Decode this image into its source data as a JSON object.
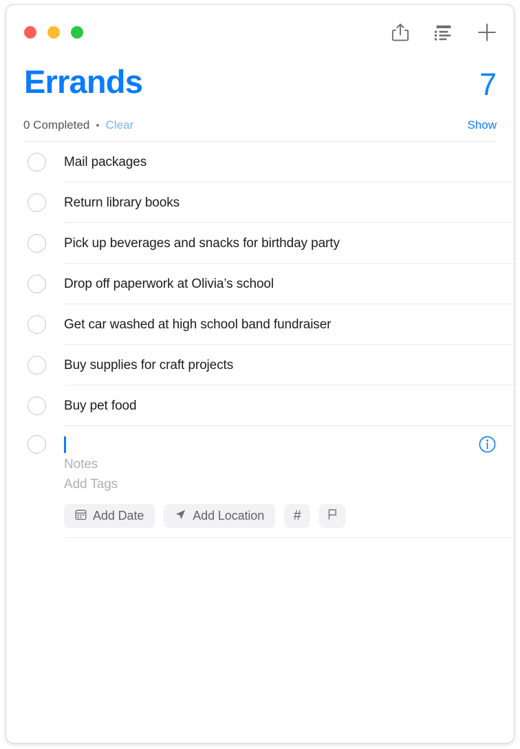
{
  "window": {
    "traffic_lights": [
      {
        "name": "close",
        "color": "#ff5f57"
      },
      {
        "name": "minimize",
        "color": "#febc2e"
      },
      {
        "name": "zoom",
        "color": "#28c840"
      }
    ]
  },
  "toolbar": {
    "items": [
      {
        "icon": "share-icon",
        "label": "Share"
      },
      {
        "icon": "list-view-icon",
        "label": "View Options"
      },
      {
        "icon": "plus-icon",
        "label": "Add Reminder"
      }
    ]
  },
  "header": {
    "title": "Errands",
    "count": "7",
    "title_color": "#0a7cff",
    "count_color": "#0a84ff"
  },
  "completed_bar": {
    "completed_text": "0 Completed",
    "separator": "•",
    "clear_label": "Clear",
    "clear_color": "#78b4f8",
    "show_label": "Show",
    "show_color": "#0a7cff"
  },
  "tasks": [
    {
      "title": "Mail packages",
      "completed": false
    },
    {
      "title": "Return library books",
      "completed": false
    },
    {
      "title": "Pick up beverages and snacks for birthday party",
      "completed": false
    },
    {
      "title": "Drop off paperwork at Olivia’s school",
      "completed": false
    },
    {
      "title": "Get car washed at high school band fundraiser",
      "completed": false
    },
    {
      "title": "Buy supplies for craft projects",
      "completed": false
    },
    {
      "title": "Buy pet food",
      "completed": false
    }
  ],
  "compose": {
    "title_value": "",
    "notes_placeholder": "Notes",
    "tags_placeholder": "Add Tags",
    "info_icon": "info-circle-icon",
    "info_color": "#0a7cff",
    "caret_color": "#0a7cff",
    "chips": [
      {
        "icon": "calendar-icon",
        "label": "Add Date"
      },
      {
        "icon": "location-arrow-icon",
        "label": "Add Location"
      },
      {
        "icon": "hashtag-icon",
        "label": "#"
      },
      {
        "icon": "flag-icon",
        "label": ""
      }
    ]
  }
}
